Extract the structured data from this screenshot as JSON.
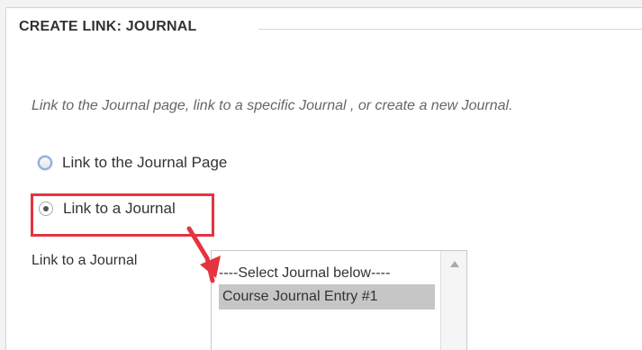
{
  "section": {
    "title": "CREATE LINK: JOURNAL"
  },
  "instructions": {
    "text": "Link to the Journal page, link to a specific Journal , or create a new Journal."
  },
  "options": [
    {
      "label": "Link to the Journal Page",
      "checked": false
    },
    {
      "label": "Link to a Journal",
      "checked": true
    }
  ],
  "journal_select": {
    "label": "Link to a Journal",
    "items": [
      "----Select Journal below----",
      "Course Journal Entry #1"
    ],
    "selected_value": "Course Journal Entry #1"
  },
  "annotation": {
    "highlight_color": "#e4343f",
    "arrow_color": "#e4343f"
  },
  "icons": {
    "unchecked_radio": "radio-button-unchecked-icon",
    "checked_radio": "radio-button-checked-icon",
    "scroll_up": "scroll-up-arrow-icon",
    "callout_arrow": "red-callout-arrow-icon"
  },
  "colors": {
    "background": "#f3f3f3",
    "panel": "#ffffff",
    "text": "#333333",
    "muted_text": "#666666",
    "selection": "#c6c6c6",
    "radio_focus": "#8ea9de"
  }
}
